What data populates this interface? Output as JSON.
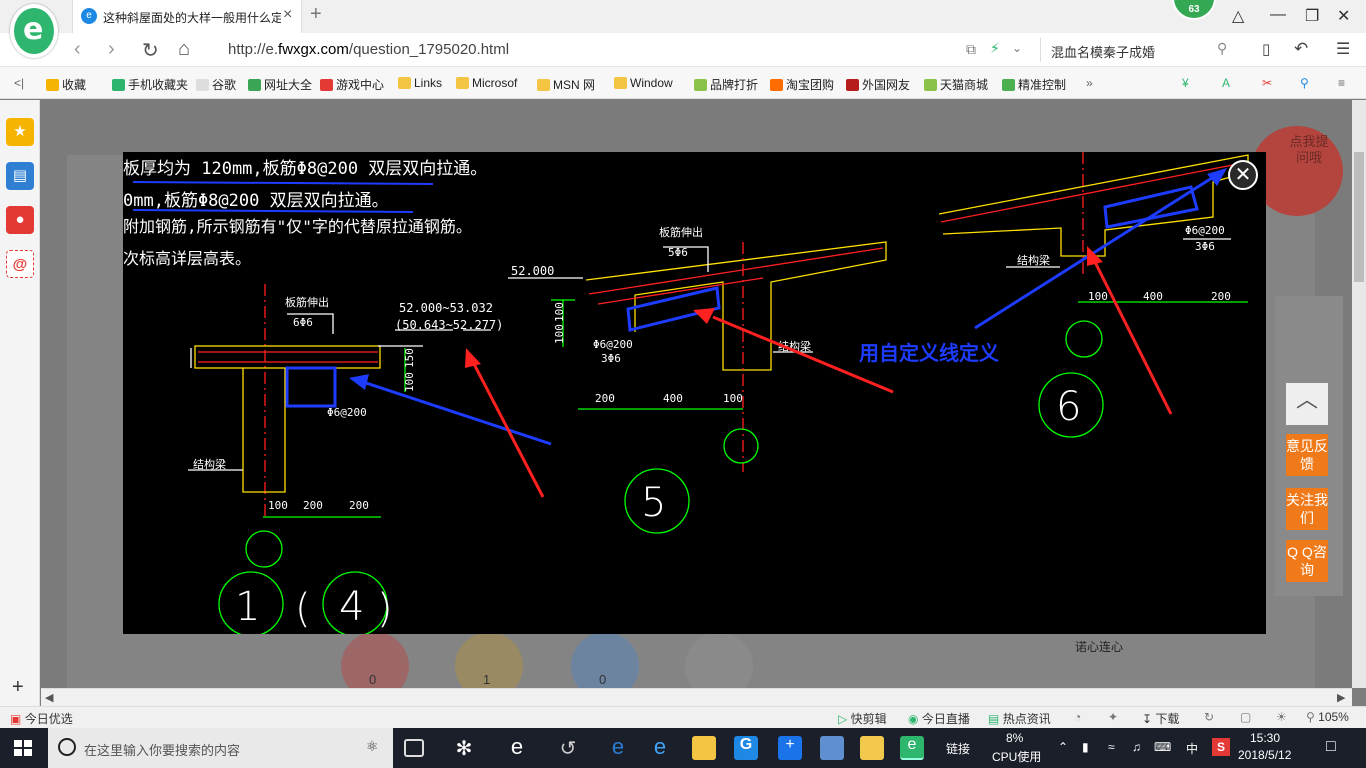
{
  "browser": {
    "tab_title": "这种斜屋面处的大样一般用什么定义",
    "notification_count": "63",
    "url_prefix": "http://e.",
    "url_host": "fwxgx.com",
    "url_path": "/question_1795020.html",
    "search_text": "混血名模秦子成婚"
  },
  "favorites": [
    {
      "label": "收藏",
      "color": "#f5b400"
    },
    {
      "label": "手机收藏夹",
      "color": "#2eb66f"
    },
    {
      "label": "谷歌",
      "color": "#dddddd"
    },
    {
      "label": "网址大全",
      "color": "#3aa655"
    },
    {
      "label": "游戏中心",
      "color": "#e53935"
    },
    {
      "label": "Links",
      "color": "#f4c542"
    },
    {
      "label": "Microsof",
      "color": "#f4c542"
    },
    {
      "label": "MSN 网",
      "color": "#f4c542"
    },
    {
      "label": "Window",
      "color": "#f4c542"
    },
    {
      "label": "品牌打折",
      "color": "#8bc34a"
    },
    {
      "label": "淘宝团购",
      "color": "#ff6d00"
    },
    {
      "label": "外国网友",
      "color": "#b71c1c"
    },
    {
      "label": "天猫商城",
      "color": "#8bc34a"
    },
    {
      "label": "精准控制",
      "color": "#4caf50"
    }
  ],
  "page": {
    "side_float": "点我提问哦",
    "back_top": "︿",
    "feedback": "意见反馈",
    "follow": "关注我们",
    "qq": "Q Q咨询",
    "partial_text": "诺心连心",
    "counts": [
      "0",
      "1",
      "0"
    ]
  },
  "drawing": {
    "notes": [
      "板厚均为 120mm,板筋Φ8@200 双层双向拉通。",
      "0mm,板筋Φ8@200 双层双向拉通。",
      "附加钢筋,所示钢筋有\"仅\"字的代替原拉通钢筋。",
      "次标高详层高表。"
    ],
    "elev_left": "52.000~53.032",
    "elev_left2": "(50.643~52.277)",
    "elev_mid": "52.000",
    "label_slab_left": "板筋伸出",
    "label_slab_left_bar": "6Φ6",
    "label_stirrup_left": "Φ6@200",
    "label_beam_left": "结构梁",
    "dims_left": [
      "100",
      "200",
      "200"
    ],
    "dims_height_left": [
      "150",
      "100"
    ],
    "label_slab_mid": "板筋伸出",
    "label_slab_mid_bar": "5Φ6",
    "label_stirrup_mid": "Φ6@200",
    "label_stirrup_mid2": "3Φ6",
    "label_beam_mid": "结构梁",
    "dims_mid": [
      "200",
      "400",
      "100"
    ],
    "dims_height_mid": [
      "100",
      "100"
    ],
    "label_stirrup_right": "Φ6@200",
    "label_stirrup_right2": "3Φ6",
    "label_beam_right": "结构梁",
    "dims_right": [
      "100",
      "400",
      "200"
    ],
    "circle_labels": [
      "1",
      "(",
      "4",
      ")",
      "5",
      "6"
    ],
    "annotation": "用自定义线定义"
  },
  "statusbar": {
    "left": "今日优选",
    "items": [
      "快剪辑",
      "今日直播",
      "热点资讯",
      "下载"
    ],
    "zoom": "105%"
  },
  "taskbar": {
    "search_placeholder": "在这里输入你要搜索的内容",
    "link_label": "链接",
    "cpu_percent": "8%",
    "cpu_label": "CPU使用",
    "ime": "中",
    "time": "15:30",
    "date": "2018/5/12"
  }
}
